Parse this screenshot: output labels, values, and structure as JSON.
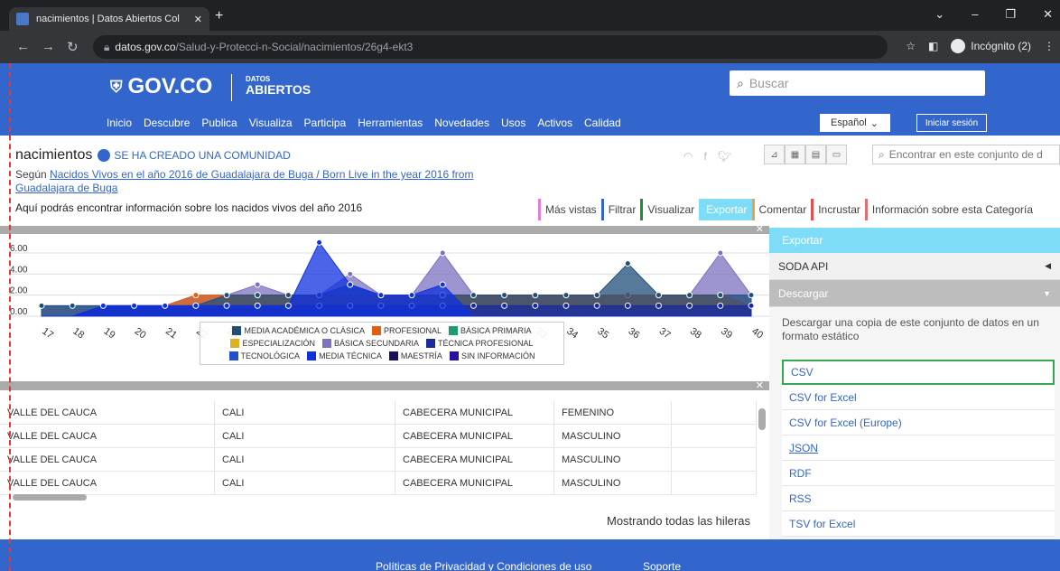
{
  "browser": {
    "tab_title": "nacimientos | Datos Abiertos Col",
    "tab_close": "✕",
    "new_tab": "+",
    "url_host": "datos.gov.co",
    "url_path": "/Salud-y-Protecci-n-Social/nacimientos/26g4-ekt3",
    "profile": "Incógnito (2)"
  },
  "site": {
    "logo": "GOV.CO",
    "datos_small": "DATOS",
    "datos_big": "ABIERTOS",
    "search_placeholder": "Buscar",
    "nav": [
      "Inicio",
      "Descubre",
      "Publica",
      "Visualiza",
      "Participa",
      "Herramientas",
      "Novedades",
      "Usos",
      "Activos",
      "Calidad"
    ],
    "language": "Español",
    "login": "Iniciar sesión"
  },
  "dataset": {
    "title": "nacimientos",
    "community": "SE HA CREADO UNA COMUNIDAD",
    "segun_prefix": "Según",
    "segun_link": "Nacidos Vivos en el año 2016 de Guadalajara de Buga / Born Live in the year 2016 from Guadalajara de Buga",
    "description": "Aquí podrás encontrar información sobre los nacidos vivos del año 2016",
    "search_placeholder": "Encontrar en este conjunto de d",
    "action_tabs": [
      {
        "label": "Más vistas",
        "color": "#e07be0"
      },
      {
        "label": "Filtrar",
        "color": "#3366cc"
      },
      {
        "label": "Visualizar",
        "color": "#1e8e3e"
      },
      {
        "label": "Exportar",
        "color": "#7fdcf7"
      },
      {
        "label": "Comentar",
        "color": "#f0a040"
      },
      {
        "label": "Incrustar",
        "color": "#e05050"
      },
      {
        "label": "Información sobre esta Categoría",
        "color": "#e07070"
      }
    ]
  },
  "chart_data": {
    "type": "area",
    "x": [
      "17",
      "18",
      "19",
      "20",
      "21",
      "22",
      "23",
      "24",
      "25",
      "26",
      "27",
      "28",
      "29",
      "30",
      "31",
      "32",
      "33",
      "34",
      "35",
      "36",
      "37",
      "38",
      "39",
      "40"
    ],
    "ytick_labels": [
      "0.00",
      "2.00",
      "4.00",
      "6.00"
    ],
    "ylim": [
      0,
      6
    ],
    "series": [
      {
        "name": "MEDIA ACADÉMICA O CLÁSICA",
        "color": "#1f4e79"
      },
      {
        "name": "PROFESIONAL",
        "color": "#e06010"
      },
      {
        "name": "BÁSICA PRIMARIA",
        "color": "#1a9e6e"
      },
      {
        "name": "ESPECIALIZACIÓN",
        "color": "#e0b020"
      },
      {
        "name": "BÁSICA SECUNDARIA",
        "color": "#7b72c0"
      },
      {
        "name": "TÉCNICA PROFESIONAL",
        "color": "#1a2a9e"
      },
      {
        "name": "TECNOLÓGICA",
        "color": "#2050d0"
      },
      {
        "name": "MEDIA TÉCNICA",
        "color": "#1030e0"
      },
      {
        "name": "MAESTRÍA",
        "color": "#1a1060"
      },
      {
        "name": "SIN INFORMACIÓN",
        "color": "#2a10a0"
      }
    ],
    "areas": [
      {
        "series": "BÁSICA SECUNDARIA",
        "values": [
          1,
          1,
          1,
          1,
          1,
          2,
          2,
          3,
          2,
          2,
          4,
          2,
          2,
          6,
          2,
          2,
          2,
          2,
          2,
          2,
          2,
          2,
          6,
          2
        ]
      },
      {
        "series": "PROFESIONAL",
        "values": [
          0,
          0,
          1,
          1,
          1,
          2,
          2,
          2,
          2,
          2,
          2,
          2,
          2,
          2,
          2,
          2,
          2,
          2,
          2,
          2,
          2,
          2,
          2,
          1
        ]
      },
      {
        "series": "MEDIA ACADÉMICA O CLÁSICA",
        "values": [
          1,
          1,
          1,
          1,
          1,
          1,
          2,
          2,
          2,
          2,
          3,
          2,
          2,
          2,
          2,
          2,
          2,
          2,
          2,
          5,
          2,
          2,
          2,
          2
        ]
      },
      {
        "series": "TÉCNICA PROFESIONAL",
        "values": [
          0,
          0,
          1,
          1,
          1,
          1,
          1,
          1,
          1,
          1,
          1,
          1,
          1,
          1,
          1,
          1,
          1,
          1,
          1,
          1,
          1,
          1,
          1,
          1
        ]
      },
      {
        "series": "MEDIA TÉCNICA",
        "values": [
          0,
          0,
          1,
          1,
          1,
          1,
          1,
          1,
          1,
          7,
          3,
          2,
          2,
          3,
          0,
          0,
          0,
          0,
          0,
          0,
          0,
          0,
          0,
          0
        ]
      }
    ],
    "legend_position": "bottom"
  },
  "table": {
    "rows": [
      [
        "VALLE DEL CAUCA",
        "CALI",
        "CABECERA MUNICIPAL",
        "FEMENINO",
        ""
      ],
      [
        "VALLE DEL CAUCA",
        "CALI",
        "CABECERA MUNICIPAL",
        "MASCULINO",
        ""
      ],
      [
        "VALLE DEL CAUCA",
        "CALI",
        "CABECERA MUNICIPAL",
        "MASCULINO",
        ""
      ],
      [
        "VALLE DEL CAUCA",
        "CALI",
        "CABECERA MUNICIPAL",
        "MASCULINO",
        ""
      ]
    ],
    "row_count_text": "Mostrando todas las hileras"
  },
  "sidebar": {
    "header": "Exportar",
    "soda": "SODA API",
    "descargar": "Descargar",
    "descargar_text": "Descargar una copia de este conjunto de datos en un formato estático",
    "formats": [
      "CSV",
      "CSV for Excel",
      "CSV for Excel (Europe)",
      "JSON",
      "RDF",
      "RSS",
      "TSV for Excel"
    ]
  },
  "footer": {
    "privacy": "Políticas de Privacidad y Condiciones de uso",
    "support": "Soporte"
  }
}
